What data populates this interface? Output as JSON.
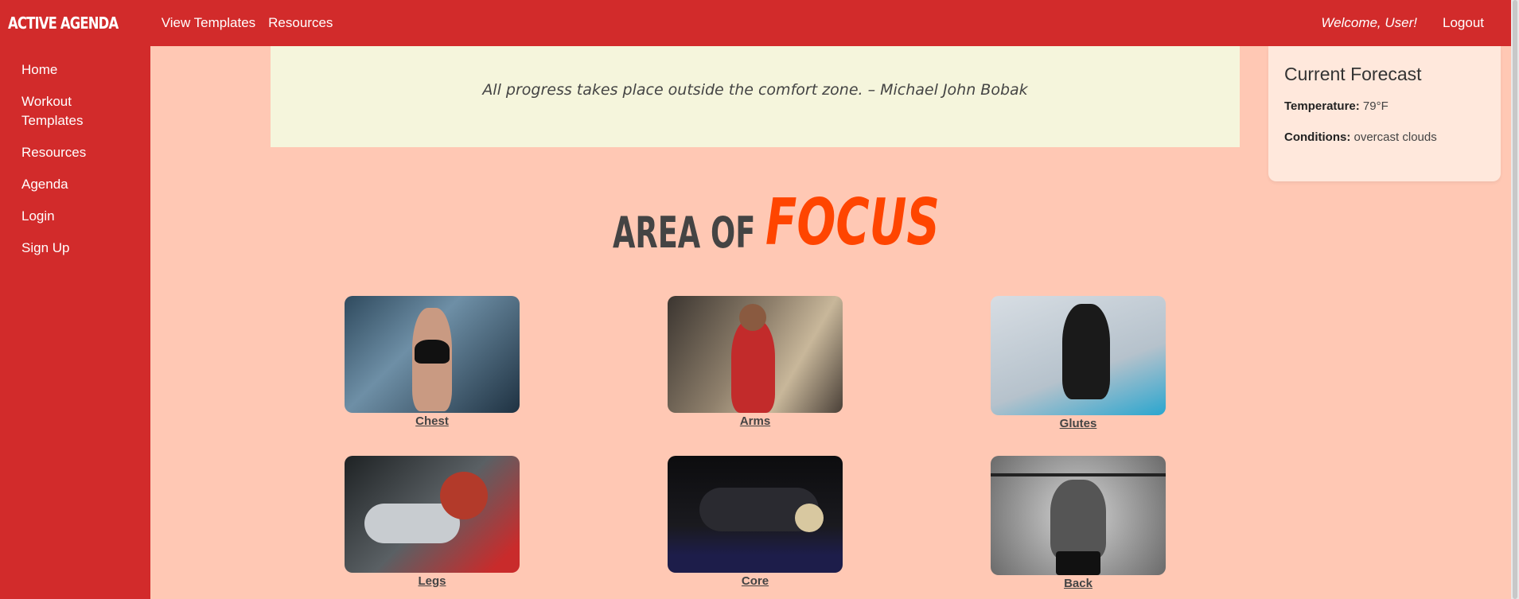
{
  "header": {
    "brand": "ACTIVE AGENDA",
    "nav": [
      "View Templates",
      "Resources"
    ],
    "welcome": "Welcome, User!",
    "logout": "Logout"
  },
  "sidebar": {
    "items": [
      {
        "label": "Home"
      },
      {
        "label": "Workout Templates"
      },
      {
        "label": "Resources"
      },
      {
        "label": "Agenda"
      },
      {
        "label": "Login"
      },
      {
        "label": "Sign Up"
      }
    ]
  },
  "quote": {
    "text": "All progress takes place outside the comfort zone. – Michael John Bobak"
  },
  "forecast": {
    "title": "Current Forecast",
    "temperature_label": "Temperature:",
    "temperature_value": "79°F",
    "conditions_label": "Conditions:",
    "conditions_value": "overcast clouds"
  },
  "focus": {
    "title_prefix": "AREA OF",
    "title_highlight": "FOCUS",
    "areas": [
      {
        "label": "Chest"
      },
      {
        "label": "Arms"
      },
      {
        "label": "Glutes"
      },
      {
        "label": "Legs"
      },
      {
        "label": "Core"
      },
      {
        "label": "Back"
      }
    ]
  },
  "colors": {
    "brand_red": "#d22b2b",
    "page_bg": "#ffc8b4",
    "quote_bg": "#f5f5dc",
    "focus_accent": "#ff4500"
  }
}
